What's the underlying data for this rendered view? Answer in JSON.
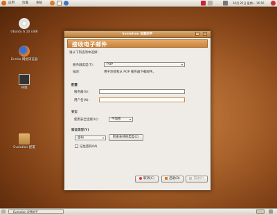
{
  "colors": {
    "accent": "#c9843f",
    "panel": "#e6e1d8",
    "title_bar": "#b57c3f"
  },
  "top_panel": {
    "menus": [
      "应用",
      "位置",
      "系统"
    ],
    "clock": "10月 25日 星期一 16:56"
  },
  "desktop": {
    "icons": [
      {
        "name": "cd-icon",
        "label": "Ubuntu 6.10 i386"
      },
      {
        "name": "firefox-icon",
        "label": "Firefox 网络浏览器"
      },
      {
        "name": "terminal-icon",
        "label": "终端"
      },
      {
        "name": "folder-icon",
        "label": "Evolution 配置"
      }
    ]
  },
  "dialog": {
    "title": "Evolution 设置助手",
    "heading": "接收电子邮件",
    "intro": "请从下列选项中选择：",
    "server_type_label": "服务器类型(T)：",
    "server_type_value": "POP",
    "description_label": "描述：",
    "description_text": "用于连接和从 POP 服务器下载邮件。",
    "config_section": "配置",
    "server_label": "服务器(S)：",
    "username_label": "用户名(N)：",
    "security_section": "安全",
    "secure_conn_label": "使用安全连接(U)：",
    "secure_conn_value": "不加密",
    "auth_section": "验证类型(Y)",
    "auth_value": "密码",
    "check_types_button": "检查支持的类型(C)",
    "remember_password": "记住密码(M)",
    "cancel_button": "取消(C)",
    "back_button": "后退(B)",
    "forward_button": "前进(F)"
  },
  "bottom_panel": {
    "task_label": "Evolution 设置助手"
  }
}
